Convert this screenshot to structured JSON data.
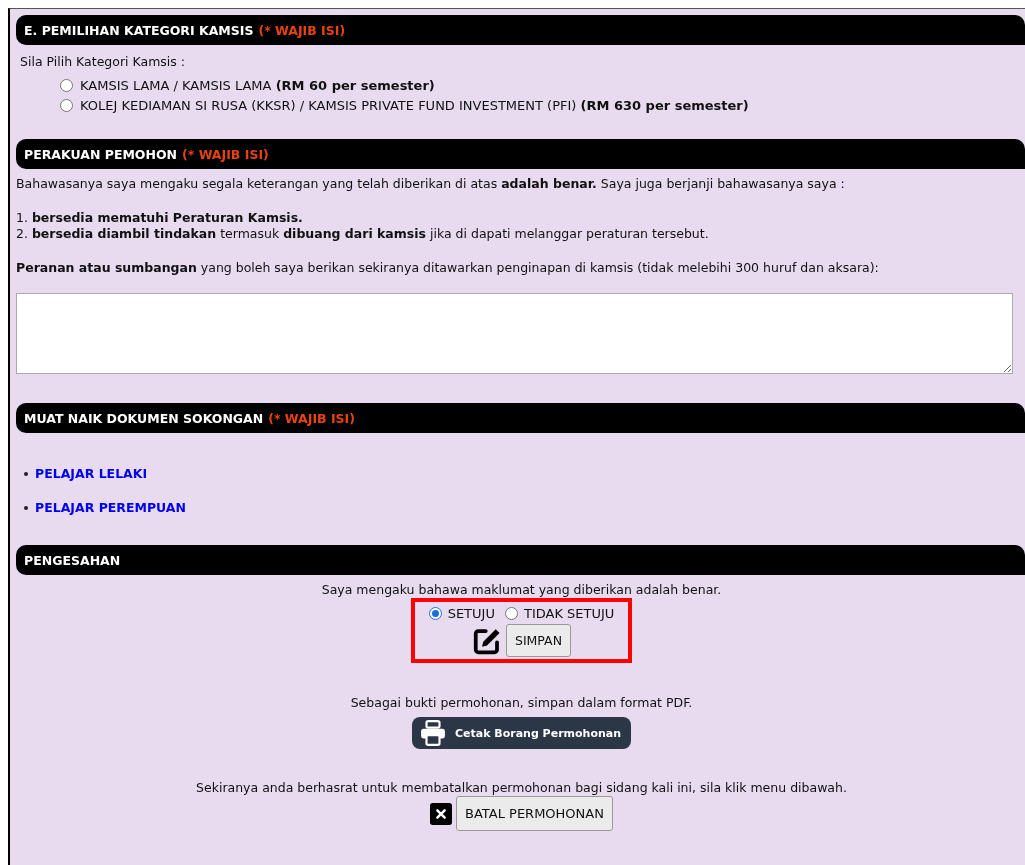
{
  "kategori": {
    "header": {
      "title": "E. PEMILIHAN KATEGORI KAMSIS",
      "required": "(* WAJIB ISI)"
    },
    "prompt": "Sila Pilih Kategori Kamsis :",
    "options": [
      {
        "label": "KAMSIS LAMA / KAMSIS LAMA **(RM 60 per semester)**",
        "selected": false
      },
      {
        "label": "KOLEJ KEDIAMAN SI RUSA (KKSR) / KAMSIS PRIVATE FUND INVESTMENT (PFI) **(RM 630 per semester)**",
        "selected": false
      }
    ]
  },
  "perakuan": {
    "header": {
      "title": "PERAKUAN PEMOHON",
      "required": "(* WAJIB ISI)"
    },
    "statement": "Bahawasanya saya mengaku segala keterangan yang telah diberikan di atas **adalah benar.** Saya juga berjanji bahawasanya saya :",
    "points": [
      "1. **bersedia mematuhi Peraturan Kamsis.**",
      "2. **bersedia diambil tindakan** termasuk **dibuang dari kamsis** jika di dapati melanggar peraturan tersebut."
    ],
    "question": "**Peranan atau sumbangan** yang boleh saya berikan sekiranya ditawarkan penginapan di kamsis (tidak melebihi 300 huruf dan aksara):"
  },
  "dokumen": {
    "header": {
      "title": "MUAT NAIK DOKUMEN SOKONGAN",
      "required": "(* WAJIB ISI)"
    },
    "links": [
      "PELAJAR LELAKI",
      "PELAJAR PEREMPUAN"
    ]
  },
  "pengesahan": {
    "header": {
      "title": "PENGESAHAN"
    },
    "statement": "Saya mengaku bahawa maklumat yang diberikan adalah benar.",
    "choices": [
      {
        "label": "SETUJU",
        "selected": true
      },
      {
        "label": "TIDAK SETUJU",
        "selected": false
      }
    ],
    "save_button": "SIMPAN",
    "print_note": "Sebagai bukti permohonan, simpan dalam format PDF.",
    "print_button": "Cetak Borang Permohonan",
    "cancel_note": "Sekiranya anda berhasrat untuk membatalkan permohonan bagi sidang kali ini, sila klik menu dibawah.",
    "cancel_button": "BATAL PERMOHONAN"
  }
}
